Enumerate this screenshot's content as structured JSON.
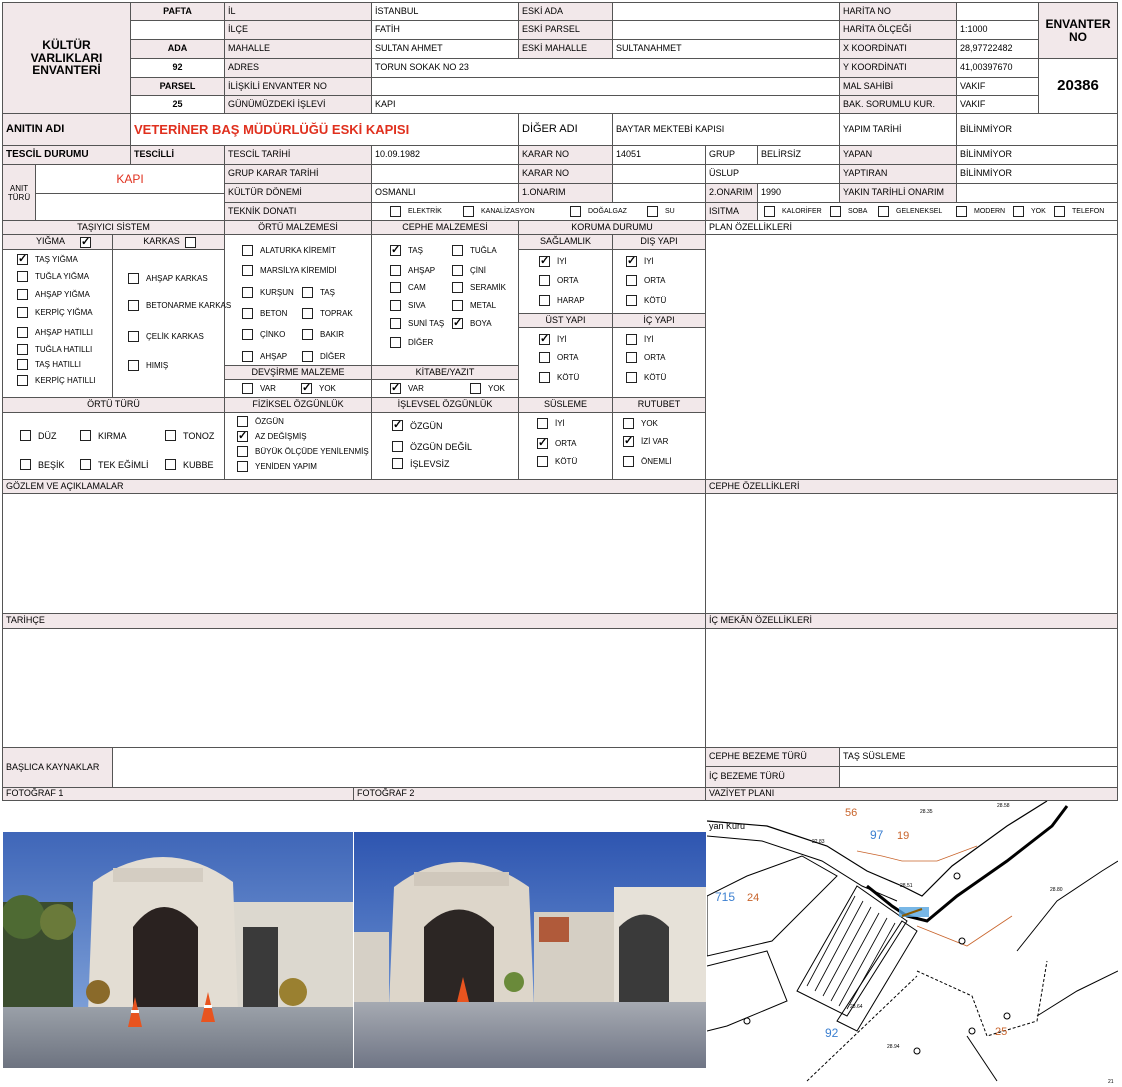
{
  "header": {
    "inventory_title": "KÜLTÜR VARLIKLARI ENVANTERİ",
    "pafta_label": "PAFTA",
    "ada_label": "ADA",
    "ada_value": "92",
    "parsel_label": "PARSEL",
    "parsel_value": "25",
    "envanter_label": "ENVANTER NO",
    "envanter_no": "20386"
  },
  "location": {
    "il_label": "İL",
    "il": "İSTANBUL",
    "ilce_label": "İLÇE",
    "ilce": "FATİH",
    "mahalle_label": "MAHALLE",
    "mahalle": "SULTAN AHMET",
    "adres_label": "ADRES",
    "adres": "TORUN SOKAK NO 23",
    "iliskili_label": "İLİŞKİLİ ENVANTER NO",
    "iliskili": "",
    "islev_label": "GÜNÜMÜZDEKİ İŞLEVİ",
    "islev": "KAPI",
    "eski_ada_label": "ESKİ ADA",
    "eski_ada": "",
    "eski_parsel_label": "ESKİ PARSEL",
    "eski_parsel": "",
    "eski_mahalle_label": "ESKİ MAHALLE",
    "eski_mahalle": "SULTANAHMET"
  },
  "map_info": {
    "harita_no_label": "HARİTA NO",
    "harita_no": "",
    "olcek_label": "HARİTA ÖLÇEĞİ",
    "olcek": "1:1000",
    "x_label": "X KOORDİNATI",
    "x": "28,97722482",
    "y_label": "Y KOORDİNATI",
    "y": "41,00397670",
    "mal_sahibi_label": "MAL SAHİBİ",
    "mal_sahibi": "VAKIF",
    "bak_label": "BAK. SORUMLU KUR.",
    "bak": "VAKIF"
  },
  "monument": {
    "anit_adi_label": "ANITIN ADI",
    "anit_adi": "VETERİNER BAŞ MÜDÜRLÜĞÜ ESKİ KAPISI",
    "diger_adi_label": "DİĞER ADI",
    "diger_adi": "BAYTAR MEKTEBİ KAPISI",
    "yapim_tarihi_label": "YAPIM TARİHİ",
    "yapim_tarihi": "BİLİNMİYOR",
    "tescil_durumu_label": "TESCİL DURUMU",
    "tescil_durumu": "TESCİLLİ",
    "tescil_tarihi_label": "TESCİL TARİHİ",
    "tescil_tarihi": "10.09.1982",
    "karar_no_label": "KARAR NO",
    "karar_no": "14051",
    "grup_label": "GRUP",
    "grup": "BELİRSİZ",
    "yapan_label": "YAPAN",
    "yapan": "BİLİNMİYOR",
    "anit_turu_label": "ANIT TÜRÜ",
    "anit_turu": "KAPI",
    "grup_karar_label": "GRUP KARAR TARİHİ",
    "grup_karar": "",
    "karar_no2_label": "KARAR NO",
    "karar_no2": "",
    "uslup_label": "ÜSLUP",
    "uslup": "",
    "yaptiran_label": "YAPTIRAN",
    "yaptiran": "BİLİNMİYOR",
    "donem_label": "KÜLTÜR DÖNEMİ",
    "donem": "OSMANLI",
    "onarim1_label": "1.ONARIM",
    "onarim1": "",
    "onarim2_label": "2.ONARIM",
    "onarim2": "1990",
    "yakin_label": "YAKIN TARİHLİ ONARIM",
    "yakin": "",
    "teknik_label": "TEKNİK DONATI",
    "isitma_label": "ISITMA"
  },
  "donati": [
    {
      "label": "ELEKTRİK",
      "checked": false
    },
    {
      "label": "KANALİZASYON",
      "checked": false
    },
    {
      "label": "DOĞALGAZ",
      "checked": false
    },
    {
      "label": "SU",
      "checked": false
    }
  ],
  "isitma": [
    {
      "label": "KALORİFER",
      "checked": false
    },
    {
      "label": "SOBA",
      "checked": false
    },
    {
      "label": "GELENEKSEL",
      "checked": false
    },
    {
      "label": "MODERN",
      "checked": false
    },
    {
      "label": "YOK",
      "checked": false
    },
    {
      "label": "TELEFON",
      "checked": false
    }
  ],
  "sections": {
    "tasiyici": "TAŞIYICI SİSTEM",
    "ortu_malz": "ÖRTÜ MALZEMESİ",
    "cephe_malz": "CEPHE MALZEMESİ",
    "koruma": "KORUMA DURUMU",
    "plan": "PLAN ÖZELLİKLERİ",
    "yigma": "YIĞMA",
    "karkas": "KARKAS",
    "saglamlik": "SAĞLAMLIK",
    "dis_yapi": "DIŞ YAPI",
    "ust_yapi": "ÜST YAPI",
    "ic_yapi": "İÇ YAPI",
    "devsirme": "DEVŞİRME MALZEME",
    "kitabe": "KİTABE/YAZIT",
    "ortu_turu": "ÖRTÜ TÜRÜ",
    "fiziksel": "FİZİKSEL ÖZGÜNLÜK",
    "islevsel": "İŞLEVSEL ÖZGÜNLÜK",
    "susleme": "SÜSLEME",
    "rutubet": "RUTUBET",
    "gozlem": "GÖZLEM VE AÇIKLAMALAR",
    "cephe_oz": "CEPHE ÖZELLİKLERİ",
    "tarihce": "TARİHÇE",
    "ic_mekan": "İÇ MEKÂN ÖZELLİKLERİ",
    "kaynaklar": "BAŞLICA KAYNAKLAR",
    "cephe_bezeme": "CEPHE BEZEME TÜRÜ",
    "cephe_bezeme_val": "TAŞ SÜSLEME",
    "ic_bezeme": "İÇ BEZEME TÜRÜ",
    "ic_bezeme_val": "",
    "foto1": "FOTOĞRAF 1",
    "foto2": "FOTOĞRAF 2",
    "vaziyet": "VAZİYET PLANI"
  },
  "yigma_checked": true,
  "karkas_checked": false,
  "yigma_items": [
    {
      "label": "TAŞ YIĞMA",
      "checked": true
    },
    {
      "label": "TUĞLA YIĞMA",
      "checked": false
    },
    {
      "label": "AHŞAP YIĞMA",
      "checked": false
    },
    {
      "label": "KERPİÇ YIĞMA",
      "checked": false
    },
    {
      "label": "AHŞAP HATILLI",
      "checked": false
    },
    {
      "label": "TUĞLA HATILLI",
      "checked": false
    },
    {
      "label": "TAŞ HATILLI",
      "checked": false
    },
    {
      "label": "KERPİÇ HATILLI",
      "checked": false
    }
  ],
  "karkas_items": [
    {
      "label": "AHŞAP KARKAS",
      "checked": false
    },
    {
      "label": "BETONARME KARKAS",
      "checked": false
    },
    {
      "label": "ÇELİK KARKAS",
      "checked": false
    },
    {
      "label": "HIMIŞ",
      "checked": false
    }
  ],
  "ortu_items": [
    {
      "label": "ALATURKA KİREMİT",
      "checked": false
    },
    {
      "label": "MARSİLYA KİREMİDİ",
      "checked": false
    },
    {
      "label": "KURŞUN",
      "checked": false
    },
    {
      "label": "TAŞ",
      "checked": false
    },
    {
      "label": "BETON",
      "checked": false
    },
    {
      "label": "TOPRAK",
      "checked": false
    },
    {
      "label": "ÇİNKO",
      "checked": false
    },
    {
      "label": "BAKIR",
      "checked": false
    },
    {
      "label": "AHŞAP",
      "checked": false
    },
    {
      "label": "DİĞER",
      "checked": false
    }
  ],
  "cephe_items": [
    {
      "label": "TAŞ",
      "checked": true
    },
    {
      "label": "TUĞLA",
      "checked": false
    },
    {
      "label": "AHŞAP",
      "checked": false
    },
    {
      "label": "ÇİNİ",
      "checked": false
    },
    {
      "label": "CAM",
      "checked": false
    },
    {
      "label": "SERAMİK",
      "checked": false
    },
    {
      "label": "SIVA",
      "checked": false
    },
    {
      "label": "METAL",
      "checked": false
    },
    {
      "label": "SUNİ TAŞ",
      "checked": false
    },
    {
      "label": "BOYA",
      "checked": true
    },
    {
      "label": "DİĞER",
      "checked": false
    }
  ],
  "saglamlik": [
    {
      "label": "İYİ",
      "checked": true
    },
    {
      "label": "ORTA",
      "checked": false
    },
    {
      "label": "HARAP",
      "checked": false
    }
  ],
  "dis_yapi": [
    {
      "label": "İYİ",
      "checked": true
    },
    {
      "label": "ORTA",
      "checked": false
    },
    {
      "label": "KÖTÜ",
      "checked": false
    }
  ],
  "ust_yapi": [
    {
      "label": "İYİ",
      "checked": true
    },
    {
      "label": "ORTA",
      "checked": false
    },
    {
      "label": "KÖTÜ",
      "checked": false
    }
  ],
  "ic_yapi": [
    {
      "label": "İYİ",
      "checked": false
    },
    {
      "label": "ORTA",
      "checked": false
    },
    {
      "label": "KÖTÜ",
      "checked": false
    }
  ],
  "devsirme": [
    {
      "label": "VAR",
      "checked": false
    },
    {
      "label": "YOK",
      "checked": true
    }
  ],
  "kitabe": [
    {
      "label": "VAR",
      "checked": true
    },
    {
      "label": "YOK",
      "checked": false
    }
  ],
  "ortu_turu": [
    {
      "label": "DÜZ",
      "checked": false
    },
    {
      "label": "KIRMA",
      "checked": false
    },
    {
      "label": "TONOZ",
      "checked": false
    },
    {
      "label": "BEŞİK",
      "checked": false
    },
    {
      "label": "TEK EĞİMLİ",
      "checked": false
    },
    {
      "label": "KUBBE",
      "checked": false
    }
  ],
  "fiziksel": [
    {
      "label": "ÖZGÜN",
      "checked": false
    },
    {
      "label": "AZ DEĞİŞMİŞ",
      "checked": true
    },
    {
      "label": "BÜYÜK ÖLÇÜDE YENİLENMİŞ",
      "checked": false
    },
    {
      "label": "YENİDEN YAPIM",
      "checked": false
    }
  ],
  "islevsel": [
    {
      "label": "ÖZGÜN",
      "checked": true
    },
    {
      "label": "ÖZGÜN DEĞİL",
      "checked": false
    },
    {
      "label": "İŞLEVSİZ",
      "checked": false
    }
  ],
  "susleme": [
    {
      "label": "İYİ",
      "checked": false
    },
    {
      "label": "ORTA",
      "checked": true
    },
    {
      "label": "KÖTÜ",
      "checked": false
    }
  ],
  "rutubet": [
    {
      "label": "YOK",
      "checked": false
    },
    {
      "label": "İZİ VAR",
      "checked": true
    },
    {
      "label": "ÖNEMLİ",
      "checked": false
    }
  ],
  "map_labels": {
    "street": "yan Kuru",
    "n56": "56",
    "n97": "97",
    "n19": "19",
    "n715": "715",
    "n24": "24",
    "n92": "92",
    "n25": "25",
    "h1": "28.35",
    "h2": "28.58",
    "h3": "22.83",
    "h4": "28.51",
    "h5": "28.80",
    "h6": "28.64",
    "h7": "28.94",
    "corner": "21"
  },
  "colors": {
    "title_red": "#e0301e",
    "anit_turu_red": "#e0301e",
    "cell_pink": "#f2e8ea",
    "map_blue": "#3b7fd0",
    "map_orange": "#c8632a"
  }
}
